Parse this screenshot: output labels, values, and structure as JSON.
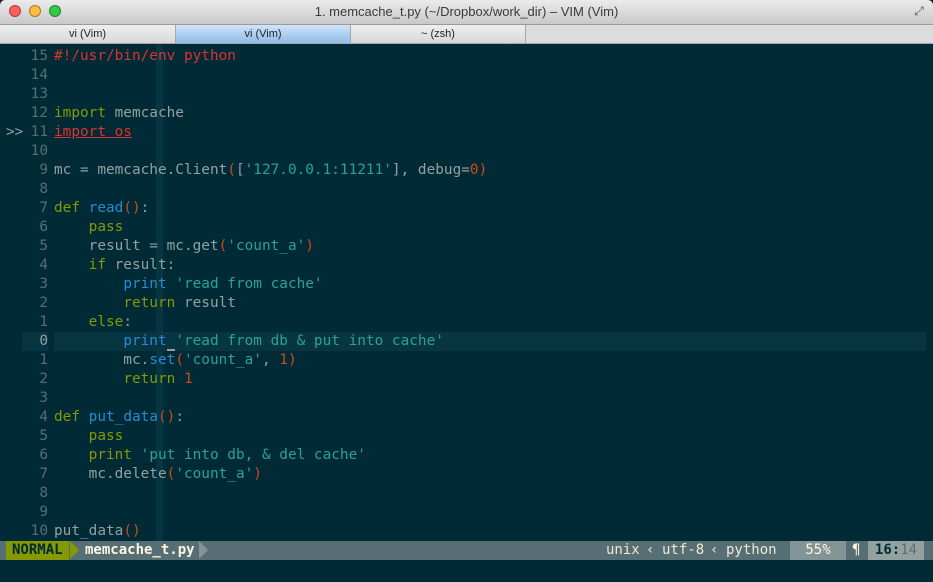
{
  "window": {
    "title": "1. memcache_t.py (~/Dropbox/work_dir) – VIM (Vim)"
  },
  "tabs": [
    {
      "label": "vi (Vim)",
      "active": false
    },
    {
      "label": "vi (Vim)",
      "active": true
    },
    {
      "label": "~ (zsh)",
      "active": false
    }
  ],
  "editor": {
    "sign_marker": ">>",
    "lines": [
      {
        "num": "15",
        "code": "#!/usr/bin/env python"
      },
      {
        "num": "14",
        "code": ""
      },
      {
        "num": "13",
        "code": ""
      },
      {
        "num": "12",
        "code": "import memcache"
      },
      {
        "num": "11",
        "code": "import os"
      },
      {
        "num": "10",
        "code": ""
      },
      {
        "num": "9",
        "code": "mc = memcache.Client(['127.0.0.1:11211'], debug=0)"
      },
      {
        "num": "8",
        "code": ""
      },
      {
        "num": "7",
        "code": "def read():"
      },
      {
        "num": "6",
        "code": "    pass"
      },
      {
        "num": "5",
        "code": "    result = mc.get('count_a')"
      },
      {
        "num": "4",
        "code": "    if result:"
      },
      {
        "num": "3",
        "code": "        print 'read from cache'"
      },
      {
        "num": "2",
        "code": "        return result"
      },
      {
        "num": "1",
        "code": "    else:"
      },
      {
        "num": "0",
        "code": "        print 'read from db & put into cache'"
      },
      {
        "num": "1",
        "code": "        mc.set('count_a', 1)"
      },
      {
        "num": "2",
        "code": "        return 1"
      },
      {
        "num": "3",
        "code": ""
      },
      {
        "num": "4",
        "code": "def put_data():"
      },
      {
        "num": "5",
        "code": "    pass"
      },
      {
        "num": "6",
        "code": "    print 'put into db, & del cache'"
      },
      {
        "num": "7",
        "code": "    mc.delete('count_a')"
      },
      {
        "num": "8",
        "code": ""
      },
      {
        "num": "9",
        "code": ""
      },
      {
        "num": "10",
        "code": "put_data()"
      }
    ]
  },
  "statusline": {
    "mode": "NORMAL",
    "filename": "memcache_t.py",
    "fileformat": "unix",
    "encoding": "utf-8",
    "filetype": "python",
    "separator": "‹",
    "percent": "55%",
    "line": "16",
    "column": "14"
  },
  "colors": {
    "background": "#002b36",
    "keyword": "#859900",
    "string": "#2aa198",
    "builtin": "#268bd2",
    "paren": "#cb4b16",
    "error": "#dc322f"
  }
}
